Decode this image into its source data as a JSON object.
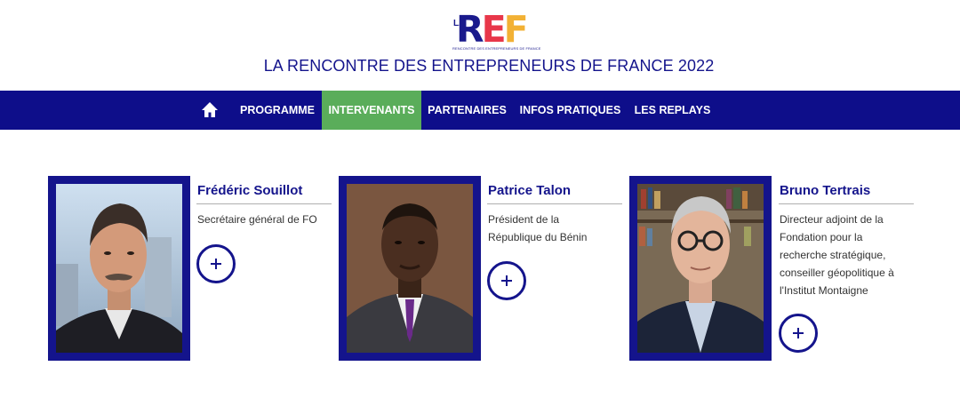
{
  "header": {
    "logo": {
      "la": "LA",
      "ref_r": "R",
      "ref_e": "E",
      "ref_f": "F",
      "subtitle": "RENCONTRE DES ENTREPRENEURS DE FRANCE"
    },
    "title": "LA RENCONTRE DES ENTREPRENEURS DE FRANCE 2022"
  },
  "nav": {
    "items": [
      {
        "label": "PROGRAMME"
      },
      {
        "label": "INTERVENANTS",
        "active": true
      },
      {
        "label": "PARTENAIRES"
      },
      {
        "label": "INFOS PRATIQUES"
      },
      {
        "label": "LES REPLAYS"
      }
    ]
  },
  "speakers": [
    {
      "name": "Frédéric Souillot",
      "desc": [
        "Secrétaire général de FO"
      ]
    },
    {
      "name": "Patrice Talon",
      "desc": [
        "Président de la",
        "République du Bénin"
      ]
    },
    {
      "name": "Bruno Tertrais",
      "desc": [
        "Directeur adjoint de la",
        "Fondation pour la",
        "recherche stratégique,",
        "conseiller géopolitique à",
        "l'Institut Montaigne"
      ]
    }
  ],
  "colors": {
    "brand": "#14148c",
    "nav_bg": "#0e0e8a",
    "nav_active": "#5aad5a"
  }
}
